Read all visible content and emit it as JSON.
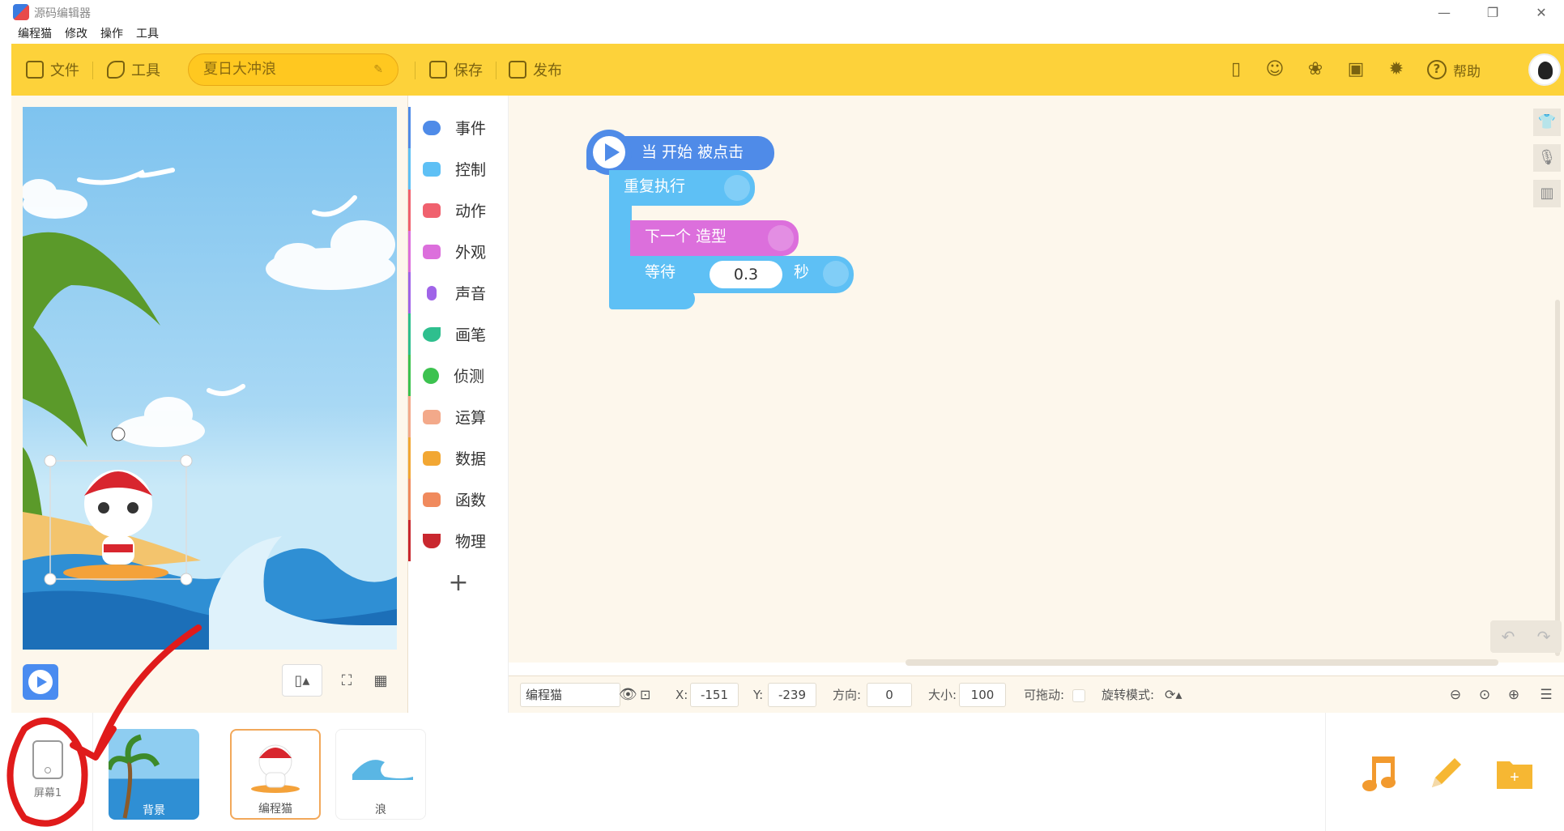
{
  "window": {
    "title": "源码编辑器",
    "minimize_icon": "minimize-icon",
    "maximize_icon": "restore-icon",
    "close_icon": "close-icon"
  },
  "menu": [
    "编程猫",
    "修改",
    "操作",
    "工具"
  ],
  "toolbar": {
    "file_label": "文件",
    "tools_label": "工具",
    "project_name": "夏日大冲浪",
    "save_label": "保存",
    "publish_label": "发布",
    "help_label": "帮助",
    "accent_color": "#fdd23a"
  },
  "categories": [
    {
      "label": "事件",
      "color": "#4f8be8"
    },
    {
      "label": "控制",
      "color": "#5ec0f5"
    },
    {
      "label": "动作",
      "color": "#f0616e"
    },
    {
      "label": "外观",
      "color": "#dc6fdc"
    },
    {
      "label": "声音",
      "color": "#a064e8"
    },
    {
      "label": "画笔",
      "color": "#2ebf8e"
    },
    {
      "label": "侦测",
      "color": "#3cc24f"
    },
    {
      "label": "运算",
      "color": "#f3a98a"
    },
    {
      "label": "数据",
      "color": "#f2a733"
    },
    {
      "label": "函数",
      "color": "#f08a5d"
    },
    {
      "label": "物理",
      "color": "#c9282f"
    }
  ],
  "blocks": {
    "hat": "当 开始 被点击",
    "repeat": "重复执行",
    "costume": "下一个 造型",
    "wait_label": "等待",
    "wait_value": "0.3",
    "wait_unit": "秒"
  },
  "props": {
    "sprite_name": "编程猫",
    "x_label": "X:",
    "x_value": "-151",
    "y_label": "Y:",
    "y_value": "-239",
    "direction_label": "方向:",
    "direction_value": "0",
    "size_label": "大小:",
    "size_value": "100",
    "draggable_label": "可拖动:",
    "rotation_label": "旋转模式:"
  },
  "tray": {
    "screen_label": "屏幕1",
    "sprites": [
      {
        "label": "背景"
      },
      {
        "label": "编程猫"
      },
      {
        "label": "浪"
      }
    ]
  }
}
